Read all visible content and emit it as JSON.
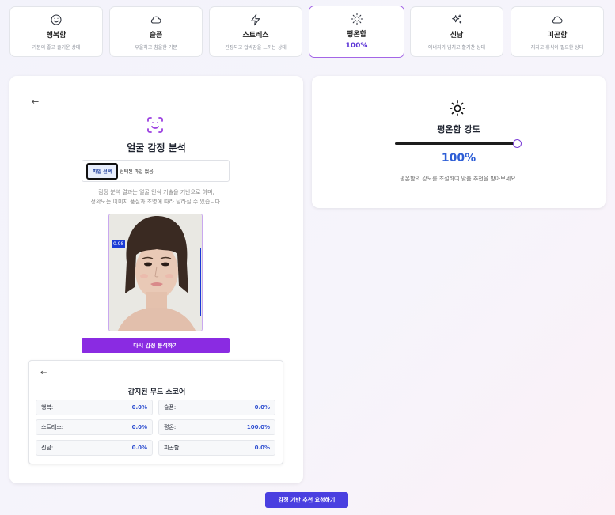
{
  "moods": [
    {
      "name": "행복함",
      "desc": "기분이 좋고 즐거운 상태",
      "icon": "smile-icon"
    },
    {
      "name": "슬픔",
      "desc": "우울하고 침울한 기분",
      "icon": "cloud-icon"
    },
    {
      "name": "스트레스",
      "desc": "긴장되고 압박감을 느끼는 상태",
      "icon": "lightning-icon"
    },
    {
      "name": "평온함",
      "pct": "100%",
      "icon": "sun-icon",
      "selected": true
    },
    {
      "name": "신남",
      "desc": "에너지가 넘치고 활기찬 상태",
      "icon": "sparkles-icon"
    },
    {
      "name": "피곤함",
      "desc": "지치고 휴식이 필요한 상태",
      "icon": "cloud-icon"
    }
  ],
  "analysis": {
    "back_icon": "←",
    "title": "얼굴 감정 분석",
    "file_button": "파일 선택",
    "file_status": "선택된 파일 없음",
    "note_line1": "감정 분석 결과는 얼굴 인식 기술을 기반으로 하며,",
    "note_line2": "정확도는 이미지 품질과 조명에 따라 달라질 수 있습니다.",
    "confidence": "0.98",
    "reanalyze_button": "다시 감정 분석하기"
  },
  "scores": {
    "back_icon": "←",
    "title": "감지된 무드 스코어",
    "items": [
      {
        "label": "행복:",
        "value": "0.0%"
      },
      {
        "label": "슬픔:",
        "value": "0.0%"
      },
      {
        "label": "스트레스:",
        "value": "0.0%"
      },
      {
        "label": "평온:",
        "value": "100.0%"
      },
      {
        "label": "신남:",
        "value": "0.0%"
      },
      {
        "label": "피곤함:",
        "value": "0.0%"
      }
    ]
  },
  "intensity": {
    "title": "평온함 강도",
    "value": "100%",
    "level": 1.0,
    "note": "평온함의 강도를 조절하여 맞춤 추천을 받아보세요."
  },
  "request_button": "감정 기반 추천 요청하기",
  "colors": {
    "accent_purple": "#8a2be2",
    "value_blue": "#2f5fd6",
    "request_button": "#4a3fe0"
  }
}
